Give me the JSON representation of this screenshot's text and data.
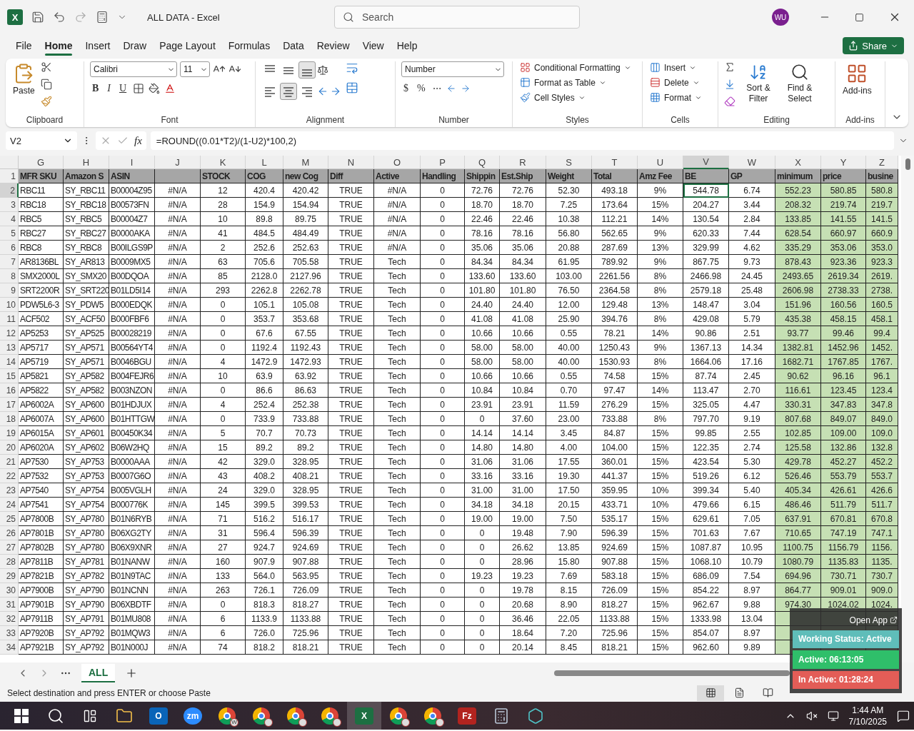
{
  "window": {
    "app_glyph": "X",
    "title": "ALL DATA - Excel",
    "search": {
      "placeholder": "Search"
    },
    "avatar": "WU"
  },
  "menu": [
    {
      "label": "File",
      "selected": false
    },
    {
      "label": "Home",
      "selected": true
    },
    {
      "label": "Insert",
      "selected": false
    },
    {
      "label": "Draw",
      "selected": false
    },
    {
      "label": "Page Layout",
      "selected": false
    },
    {
      "label": "Formulas",
      "selected": false
    },
    {
      "label": "Data",
      "selected": false
    },
    {
      "label": "Review",
      "selected": false
    },
    {
      "label": "View",
      "selected": false
    },
    {
      "label": "Help",
      "selected": false
    }
  ],
  "share": "Share",
  "ribbon": {
    "clipboard": {
      "paste": "Paste",
      "label": "Clipboard"
    },
    "font": {
      "name": "Calibri",
      "size": "11",
      "bold": "B",
      "italic": "I",
      "underline": "U",
      "label": "Font"
    },
    "alignment": {
      "vertical": [
        {
          "selected": false
        },
        {
          "selected": false
        },
        {
          "selected": true
        }
      ],
      "horizontal": [
        {
          "selected": false
        },
        {
          "selected": true
        },
        {
          "selected": false
        }
      ],
      "label": "Alignment"
    },
    "number": {
      "format": "Number",
      "currency": "$",
      "percent": "%",
      "label": "Number"
    },
    "styles": {
      "items": [
        "Conditional Formatting",
        "Format as Table",
        "Cell Styles"
      ],
      "label": "Styles"
    },
    "cells": {
      "items": [
        "Insert",
        "Delete",
        "Format"
      ],
      "label": "Cells"
    },
    "editing": {
      "items": [
        "Sort & Filter",
        "Find & Select"
      ],
      "label": "Editing"
    },
    "addins": {
      "button": "Add-ins",
      "label": "Add-ins"
    }
  },
  "formula_bar": {
    "cell": "V2",
    "fx": "fx",
    "formula": "=ROUND((0.01*T2)/(1-U2)*100,2)"
  },
  "sheet": {
    "columns": [
      {
        "letter": "G",
        "selected": false,
        "highlight": false
      },
      {
        "letter": "H",
        "selected": false,
        "highlight": false
      },
      {
        "letter": "I",
        "selected": false,
        "highlight": false
      },
      {
        "letter": "J",
        "selected": false,
        "highlight": false
      },
      {
        "letter": "K",
        "selected": false,
        "highlight": false
      },
      {
        "letter": "L",
        "selected": false,
        "highlight": false
      },
      {
        "letter": "M",
        "selected": false,
        "highlight": false
      },
      {
        "letter": "N",
        "selected": false,
        "highlight": false
      },
      {
        "letter": "O",
        "selected": false,
        "highlight": false
      },
      {
        "letter": "P",
        "selected": false,
        "highlight": false
      },
      {
        "letter": "Q",
        "selected": false,
        "highlight": false
      },
      {
        "letter": "R",
        "selected": false,
        "highlight": false
      },
      {
        "letter": "S",
        "selected": false,
        "highlight": false
      },
      {
        "letter": "T",
        "selected": false,
        "highlight": false
      },
      {
        "letter": "U",
        "selected": false,
        "highlight": false
      },
      {
        "letter": "V",
        "selected": true,
        "highlight": false
      },
      {
        "letter": "W",
        "selected": false,
        "highlight": false
      },
      {
        "letter": "X",
        "selected": false,
        "highlight": true
      },
      {
        "letter": "Y",
        "selected": false,
        "highlight": true
      },
      {
        "letter": "Z",
        "selected": false,
        "highlight": true
      }
    ],
    "header": {
      "number": "1",
      "cells": [
        "MFR SKU",
        "Amazon S",
        "ASIN",
        null,
        "STOCK",
        "COG",
        "new Cog",
        "Diff",
        "Active",
        "Handling",
        "Shippin",
        "Est.Ship",
        "Weight",
        "Total",
        "Amz Fee",
        "BE",
        "GP",
        "minimum",
        "price",
        "busine"
      ]
    },
    "rows": [
      {
        "number": "2",
        "selected": true,
        "cells": [
          "RBC11",
          "SY_RBC11",
          "B00004Z95",
          "#N/A",
          "12",
          "420.4",
          "420.42",
          "TRUE",
          "#N/A",
          "0",
          "72.76",
          "72.76",
          "52.30",
          "493.18",
          "9%",
          "544.78",
          "6.74",
          "552.23",
          "580.85",
          "580.8"
        ]
      },
      {
        "number": "3",
        "selected": false,
        "cells": [
          "RBC18",
          "SY_RBC18",
          "B00573FN",
          "#N/A",
          "28",
          "154.9",
          "154.94",
          "TRUE",
          "#N/A",
          "0",
          "18.70",
          "18.70",
          "7.25",
          "173.64",
          "15%",
          "204.27",
          "3.44",
          "208.32",
          "219.74",
          "219.7"
        ]
      },
      {
        "number": "4",
        "selected": false,
        "cells": [
          "RBC5",
          "SY_RBC5",
          "B00004Z7",
          "#N/A",
          "10",
          "89.8",
          "89.75",
          "TRUE",
          "#N/A",
          "0",
          "22.46",
          "22.46",
          "10.38",
          "112.21",
          "14%",
          "130.54",
          "2.84",
          "133.85",
          "141.55",
          "141.5"
        ]
      },
      {
        "number": "5",
        "selected": false,
        "cells": [
          "RBC27",
          "SY_RBC27",
          "B0000AKA",
          "#N/A",
          "41",
          "484.5",
          "484.49",
          "TRUE",
          "#N/A",
          "0",
          "78.16",
          "78.16",
          "56.80",
          "562.65",
          "9%",
          "620.33",
          "7.44",
          "628.54",
          "660.97",
          "660.9"
        ]
      },
      {
        "number": "6",
        "selected": false,
        "cells": [
          "RBC8",
          "SY_RBC8",
          "B00ILGS9P",
          "#N/A",
          "2",
          "252.6",
          "252.63",
          "TRUE",
          "#N/A",
          "0",
          "35.06",
          "35.06",
          "20.88",
          "287.69",
          "13%",
          "329.99",
          "4.62",
          "335.29",
          "353.06",
          "353.0"
        ]
      },
      {
        "number": "7",
        "selected": false,
        "cells": [
          "AR8136BL",
          "SY_AR813",
          "B0009MX5",
          "#N/A",
          "63",
          "705.6",
          "705.58",
          "TRUE",
          "Tech",
          "0",
          "84.34",
          "84.34",
          "61.95",
          "789.92",
          "9%",
          "867.75",
          "9.73",
          "878.43",
          "923.36",
          "923.3"
        ]
      },
      {
        "number": "8",
        "selected": false,
        "cells": [
          "SMX2000L",
          "SY_SMX20",
          "B00DQOA",
          "#N/A",
          "85",
          "2128.0",
          "2127.96",
          "TRUE",
          "Tech",
          "0",
          "133.60",
          "133.60",
          "103.00",
          "2261.56",
          "8%",
          "2466.98",
          "24.45",
          "2493.65",
          "2619.34",
          "2619."
        ]
      },
      {
        "number": "9",
        "selected": false,
        "cells": [
          "SRT2200R",
          "SY_SRT220",
          "B01LD5I14",
          "#N/A",
          "293",
          "2262.8",
          "2262.78",
          "TRUE",
          "Tech",
          "0",
          "101.80",
          "101.80",
          "76.50",
          "2364.58",
          "8%",
          "2579.18",
          "25.48",
          "2606.98",
          "2738.33",
          "2738."
        ]
      },
      {
        "number": "10",
        "selected": false,
        "cells": [
          "PDW5L6-3",
          "SY_PDW5",
          "B000EDQK",
          "#N/A",
          "0",
          "105.1",
          "105.08",
          "TRUE",
          "Tech",
          "0",
          "24.40",
          "24.40",
          "12.00",
          "129.48",
          "13%",
          "148.47",
          "3.04",
          "151.96",
          "160.56",
          "160.5"
        ]
      },
      {
        "number": "11",
        "selected": false,
        "cells": [
          "ACF502",
          "SY_ACF50",
          "B000FBF6",
          "#N/A",
          "0",
          "353.7",
          "353.68",
          "TRUE",
          "Tech",
          "0",
          "41.08",
          "41.08",
          "25.90",
          "394.76",
          "8%",
          "429.08",
          "5.79",
          "435.38",
          "458.15",
          "458.1"
        ]
      },
      {
        "number": "12",
        "selected": false,
        "cells": [
          "AP5253",
          "SY_AP525",
          "B00028219",
          "#N/A",
          "0",
          "67.6",
          "67.55",
          "TRUE",
          "Tech",
          "0",
          "10.66",
          "10.66",
          "0.55",
          "78.21",
          "14%",
          "90.86",
          "2.51",
          "93.77",
          "99.46",
          "99.4"
        ]
      },
      {
        "number": "13",
        "selected": false,
        "cells": [
          "AP5717",
          "SY_AP571",
          "B00564YT4",
          "#N/A",
          "0",
          "1192.4",
          "1192.43",
          "TRUE",
          "Tech",
          "0",
          "58.00",
          "58.00",
          "40.00",
          "1250.43",
          "9%",
          "1367.13",
          "14.34",
          "1382.81",
          "1452.96",
          "1452."
        ]
      },
      {
        "number": "14",
        "selected": false,
        "cells": [
          "AP5719",
          "SY_AP571",
          "B0046BGU",
          "#N/A",
          "4",
          "1472.9",
          "1472.93",
          "TRUE",
          "Tech",
          "0",
          "58.00",
          "58.00",
          "40.00",
          "1530.93",
          "8%",
          "1664.06",
          "17.16",
          "1682.71",
          "1767.85",
          "1767."
        ]
      },
      {
        "number": "15",
        "selected": false,
        "cells": [
          "AP5821",
          "SY_AP582",
          "B004FEJR6",
          "#N/A",
          "10",
          "63.9",
          "63.92",
          "TRUE",
          "Tech",
          "0",
          "10.66",
          "10.66",
          "0.55",
          "74.58",
          "15%",
          "87.74",
          "2.45",
          "90.62",
          "96.16",
          "96.1"
        ]
      },
      {
        "number": "16",
        "selected": false,
        "cells": [
          "AP5822",
          "SY_AP582",
          "B003NZON",
          "#N/A",
          "0",
          "86.6",
          "86.63",
          "TRUE",
          "Tech",
          "0",
          "10.84",
          "10.84",
          "0.70",
          "97.47",
          "14%",
          "113.47",
          "2.70",
          "116.61",
          "123.45",
          "123.4"
        ]
      },
      {
        "number": "17",
        "selected": false,
        "cells": [
          "AP6002A",
          "SY_AP600",
          "B01HDJUX",
          "#N/A",
          "4",
          "252.4",
          "252.38",
          "TRUE",
          "Tech",
          "0",
          "23.91",
          "23.91",
          "11.59",
          "276.29",
          "15%",
          "325.05",
          "4.47",
          "330.31",
          "347.83",
          "347.8"
        ]
      },
      {
        "number": "18",
        "selected": false,
        "cells": [
          "AP6007A",
          "SY_AP600",
          "B01HTTGW",
          "#N/A",
          "0",
          "733.9",
          "733.88",
          "TRUE",
          "Tech",
          "0",
          "0",
          "37.60",
          "23.00",
          "733.88",
          "8%",
          "797.70",
          "9.19",
          "807.68",
          "849.07",
          "849.0"
        ]
      },
      {
        "number": "19",
        "selected": false,
        "cells": [
          "AP6015A",
          "SY_AP601",
          "B00450K34",
          "#N/A",
          "5",
          "70.7",
          "70.73",
          "TRUE",
          "Tech",
          "0",
          "14.14",
          "14.14",
          "3.45",
          "84.87",
          "15%",
          "99.85",
          "2.55",
          "102.85",
          "109.00",
          "109.0"
        ]
      },
      {
        "number": "20",
        "selected": false,
        "cells": [
          "AP6020A",
          "SY_AP602",
          "B06W2HQ",
          "#N/A",
          "15",
          "89.2",
          "89.2",
          "TRUE",
          "Tech",
          "0",
          "14.80",
          "14.80",
          "4.00",
          "104.00",
          "15%",
          "122.35",
          "2.74",
          "125.58",
          "132.86",
          "132.8"
        ]
      },
      {
        "number": "21",
        "selected": false,
        "cells": [
          "AP7530",
          "SY_AP753",
          "B0000AAA",
          "#N/A",
          "42",
          "329.0",
          "328.95",
          "TRUE",
          "Tech",
          "0",
          "31.06",
          "31.06",
          "17.55",
          "360.01",
          "15%",
          "423.54",
          "5.30",
          "429.78",
          "452.27",
          "452.2"
        ]
      },
      {
        "number": "22",
        "selected": false,
        "cells": [
          "AP7532",
          "SY_AP753",
          "B0007G6O",
          "#N/A",
          "43",
          "408.2",
          "408.21",
          "TRUE",
          "Tech",
          "0",
          "33.16",
          "33.16",
          "19.30",
          "441.37",
          "15%",
          "519.26",
          "6.12",
          "526.46",
          "553.79",
          "553.7"
        ]
      },
      {
        "number": "23",
        "selected": false,
        "cells": [
          "AP7540",
          "SY_AP754",
          "B005VGLH",
          "#N/A",
          "24",
          "329.0",
          "328.95",
          "TRUE",
          "Tech",
          "0",
          "31.00",
          "31.00",
          "17.50",
          "359.95",
          "10%",
          "399.34",
          "5.40",
          "405.34",
          "426.61",
          "426.6"
        ]
      },
      {
        "number": "24",
        "selected": false,
        "cells": [
          "AP7541",
          "SY_AP754",
          "B000776K",
          "#N/A",
          "145",
          "399.5",
          "399.53",
          "TRUE",
          "Tech",
          "0",
          "34.18",
          "34.18",
          "20.15",
          "433.71",
          "10%",
          "479.66",
          "6.15",
          "486.46",
          "511.79",
          "511.7"
        ]
      },
      {
        "number": "25",
        "selected": false,
        "cells": [
          "AP7800B",
          "SY_AP780",
          "B01N6RYB",
          "#N/A",
          "71",
          "516.2",
          "516.17",
          "TRUE",
          "Tech",
          "0",
          "19.00",
          "19.00",
          "7.50",
          "535.17",
          "15%",
          "629.61",
          "7.05",
          "637.91",
          "670.81",
          "670.8"
        ]
      },
      {
        "number": "26",
        "selected": false,
        "cells": [
          "AP7801B",
          "SY_AP780",
          "B06XG2TY",
          "#N/A",
          "31",
          "596.4",
          "596.39",
          "TRUE",
          "Tech",
          "0",
          "0",
          "19.48",
          "7.90",
          "596.39",
          "15%",
          "701.63",
          "7.67",
          "710.65",
          "747.19",
          "747.1"
        ]
      },
      {
        "number": "27",
        "selected": false,
        "cells": [
          "AP7802B",
          "SY_AP780",
          "B06X9XNR",
          "#N/A",
          "27",
          "924.7",
          "924.69",
          "TRUE",
          "Tech",
          "0",
          "0",
          "26.62",
          "13.85",
          "924.69",
          "15%",
          "1087.87",
          "10.95",
          "1100.75",
          "1156.79",
          "1156."
        ]
      },
      {
        "number": "28",
        "selected": false,
        "cells": [
          "AP7811B",
          "SY_AP781",
          "B01NANW",
          "#N/A",
          "160",
          "907.9",
          "907.88",
          "TRUE",
          "Tech",
          "0",
          "0",
          "28.96",
          "15.80",
          "907.88",
          "15%",
          "1068.10",
          "10.79",
          "1080.79",
          "1135.83",
          "1135."
        ]
      },
      {
        "number": "29",
        "selected": false,
        "cells": [
          "AP7821B",
          "SY_AP782",
          "B01N9TAC",
          "#N/A",
          "133",
          "564.0",
          "563.95",
          "TRUE",
          "Tech",
          "0",
          "19.23",
          "19.23",
          "7.69",
          "583.18",
          "15%",
          "686.09",
          "7.54",
          "694.96",
          "730.71",
          "730.7"
        ]
      },
      {
        "number": "30",
        "selected": false,
        "cells": [
          "AP7900B",
          "SY_AP790",
          "B01NCNN",
          "#N/A",
          "263",
          "726.1",
          "726.09",
          "TRUE",
          "Tech",
          "0",
          "0",
          "19.78",
          "8.15",
          "726.09",
          "15%",
          "854.22",
          "8.97",
          "864.77",
          "909.01",
          "909.0"
        ]
      },
      {
        "number": "31",
        "selected": false,
        "cells": [
          "AP7901B",
          "SY_AP790",
          "B06XBDTF",
          "#N/A",
          "0",
          "818.3",
          "818.27",
          "TRUE",
          "Tech",
          "0",
          "0",
          "20.68",
          "8.90",
          "818.27",
          "15%",
          "962.67",
          "9.88",
          "974.30",
          "1024.02",
          "1024."
        ]
      },
      {
        "number": "32",
        "selected": false,
        "cells": [
          "AP7911B",
          "SY_AP791",
          "B01MU808",
          "#N/A",
          "6",
          "1133.9",
          "1133.88",
          "TRUE",
          "Tech",
          "0",
          "0",
          "36.46",
          "22.05",
          "1133.88",
          "15%",
          "1333.98",
          "13.04",
          null,
          null,
          null
        ]
      },
      {
        "number": "33",
        "selected": false,
        "cells": [
          "AP7920B",
          "SY_AP792",
          "B01MQW3",
          "#N/A",
          "6",
          "726.0",
          "725.96",
          "TRUE",
          "Tech",
          "0",
          "0",
          "18.64",
          "7.20",
          "725.96",
          "15%",
          "854.07",
          "8.97",
          null,
          null,
          null
        ]
      },
      {
        "number": "34",
        "selected": false,
        "cells": [
          "AP7921B",
          "SY_AP792",
          "B01N000J",
          "#N/A",
          "74",
          "818.2",
          "818.21",
          "TRUE",
          "Tech",
          "0",
          "0",
          "20.14",
          "8.45",
          "818.21",
          "15%",
          "962.60",
          "9.89",
          null,
          null,
          null
        ]
      }
    ]
  },
  "sheet_tabs": [
    {
      "label": "ALL",
      "selected": true
    }
  ],
  "status_bar": {
    "message": "Select destination and press ENTER or choose Paste",
    "views": [
      {
        "selected": true
      },
      {
        "selected": false
      },
      {
        "selected": false
      }
    ]
  },
  "widget": {
    "open_app": "Open App",
    "status": "Working Status: Active",
    "active": "Active: 06:13:05",
    "inactive": "In Active: 01:28:24"
  },
  "taskbar": {
    "apps": [
      {
        "kind": "start",
        "selected": false
      },
      {
        "kind": "search",
        "selected": false
      },
      {
        "kind": "task_view",
        "selected": false
      },
      {
        "kind": "explorer",
        "selected": false
      },
      {
        "kind": "outlook",
        "glyph": "O",
        "selected": false
      },
      {
        "kind": "zoom",
        "glyph": "zm",
        "selected": false
      },
      {
        "kind": "browser",
        "glyph": "W",
        "selected": false
      },
      {
        "kind": "browser_profile",
        "selected": false
      },
      {
        "kind": "browser_profile",
        "selected": false
      },
      {
        "kind": "browser_profile",
        "selected": false
      },
      {
        "kind": "excel",
        "glyph": "X",
        "selected": true
      },
      {
        "kind": "browser_profile",
        "selected": false
      },
      {
        "kind": "browser_profile",
        "selected": false
      },
      {
        "kind": "ftp",
        "glyph": "Fz",
        "selected": false
      },
      {
        "kind": "calculator",
        "selected": false
      },
      {
        "kind": "hexagon",
        "selected": false
      }
    ],
    "time": "1:44 AM",
    "date": "7/10/2025"
  }
}
